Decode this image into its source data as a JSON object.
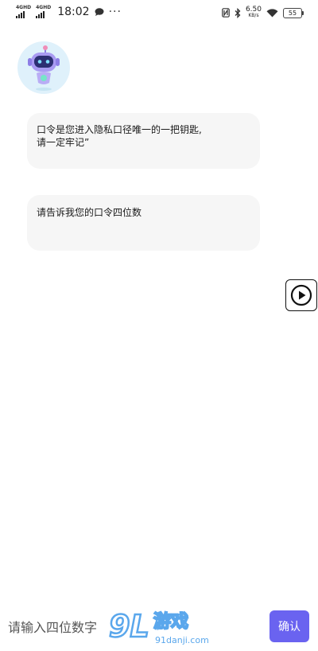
{
  "status_bar": {
    "network1": "4GHD",
    "network2": "4GHD",
    "time": "18:02",
    "more": "···",
    "net_speed_value": "6.50",
    "net_speed_unit": "KB/s",
    "battery": "55",
    "icons": [
      "nfc-icon",
      "bluetooth-icon",
      "wifi-icon",
      "message-icon"
    ]
  },
  "chat": {
    "messages": [
      {
        "lines": [
          "口令是您进入隐私口径唯一的一把钥匙,",
          "请一定牢记”"
        ]
      },
      {
        "lines": [
          "请告诉我您的口令四位数"
        ]
      }
    ]
  },
  "input": {
    "placeholder": "请输入四位数字",
    "confirm_label": "确认"
  },
  "watermark": {
    "logo": "9L",
    "brand": "游戏",
    "site": "91danji.com"
  },
  "colors": {
    "accent": "#6a63f0",
    "card_bg": "#f6f6f6",
    "avatar_bg": "#dff1fb"
  }
}
